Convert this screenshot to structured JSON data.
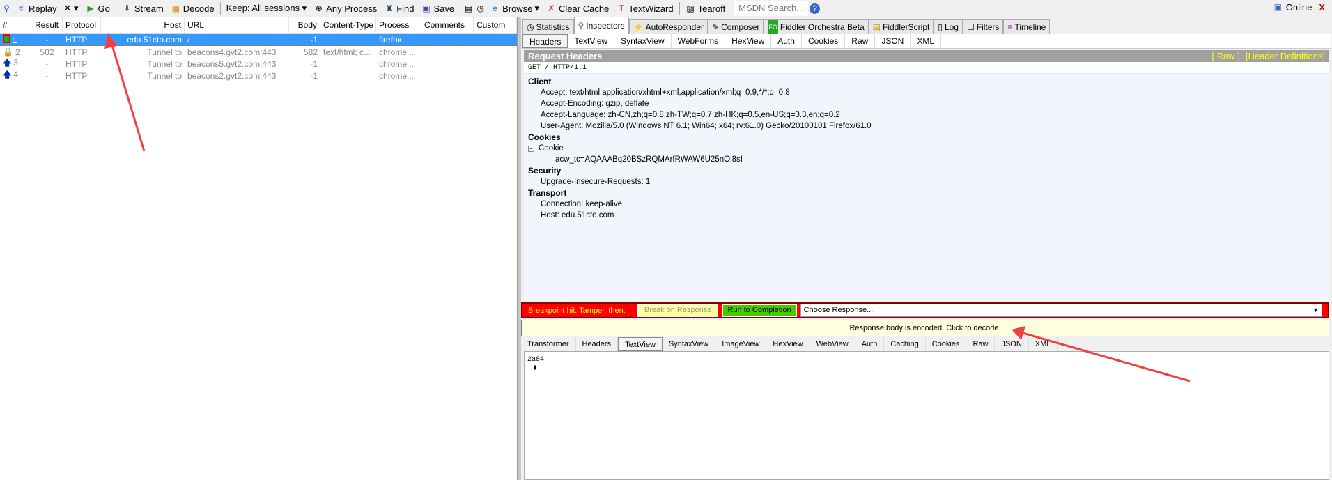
{
  "toolbar": {
    "replay": "Replay",
    "remove": "✕ ▾",
    "go": "Go",
    "stream": "Stream",
    "decode": "Decode",
    "keep": "Keep: All sessions ▾",
    "process": "Any Process",
    "find": "Find",
    "save": "Save",
    "browse": "Browse",
    "clear_cache": "Clear Cache",
    "textwizard": "TextWizard",
    "tearoff": "Tearoff",
    "msdn_placeholder": "MSDN Search...",
    "online": "Online"
  },
  "sessions": {
    "columns": [
      "#",
      "Result",
      "Protocol",
      "Host",
      "URL",
      "Body",
      "Content-Type",
      "Process",
      "Comments",
      "Custom"
    ],
    "rows": [
      {
        "id": "1",
        "result": "-",
        "protocol": "HTTP",
        "host": "edu.51cto.com",
        "url": "/",
        "body": "-1",
        "content_type": "",
        "process": "firefox:...",
        "selected": true
      },
      {
        "id": "2",
        "result": "502",
        "protocol": "HTTP",
        "host": "Tunnel to",
        "url": "beacons4.gvt2.com:443",
        "body": "582",
        "content_type": "text/html; c...",
        "process": "chrome..."
      },
      {
        "id": "3",
        "result": "-",
        "protocol": "HTTP",
        "host": "Tunnel to",
        "url": "beacons5.gvt2.com:443",
        "body": "-1",
        "content_type": "",
        "process": "chrome..."
      },
      {
        "id": "4",
        "result": "-",
        "protocol": "HTTP",
        "host": "Tunnel to",
        "url": "beacons2.gvt2.com:443",
        "body": "-1",
        "content_type": "",
        "process": "chrome..."
      }
    ]
  },
  "tabs": [
    "Statistics",
    "Inspectors",
    "AutoResponder",
    "Composer",
    "Fiddler Orchestra Beta",
    "FiddlerScript",
    "Log",
    "Filters",
    "Timeline"
  ],
  "request_tabs": [
    "Headers",
    "TextView",
    "SyntaxView",
    "WebForms",
    "HexView",
    "Auth",
    "Cookies",
    "Raw",
    "JSON",
    "XML"
  ],
  "request": {
    "title": "Request Headers",
    "raw_link": "[ Raw ]",
    "defs_link": "[Header Definitions]",
    "request_line": "GET / HTTP/1.1",
    "client": "Client",
    "accept": "Accept: text/html,application/xhtml+xml,application/xml;q=0.9,*/*;q=0.8",
    "accept_encoding": "Accept-Encoding: gzip, deflate",
    "accept_language": "Accept-Language: zh-CN,zh;q=0.8,zh-TW;q=0.7,zh-HK;q=0.5,en-US;q=0.3,en;q=0.2",
    "user_agent": "User-Agent: Mozilla/5.0 (Windows NT 6.1; Win64; x64; rv:61.0) Gecko/20100101 Firefox/61.0",
    "cookies": "Cookies",
    "cookie": "Cookie",
    "cookie_value": "acw_tc=AQAAABq20BSzRQMArfRWAW6U25nOl8sI",
    "security": "Security",
    "upgrade": "Upgrade-Insecure-Requests: 1",
    "transport": "Transport",
    "connection": "Connection: keep-alive",
    "host": "Host: edu.51cto.com"
  },
  "breakpoint": {
    "label": "Breakpoint hit. Tamper, then:",
    "break_on_response": "Break on Response",
    "run_to_completion": "Run to Completion",
    "choose_response": "Choose Response..."
  },
  "encoded_notice": "Response body is encoded. Click to decode.",
  "response_tabs": [
    "Transformer",
    "Headers",
    "TextView",
    "SyntaxView",
    "ImageView",
    "HexView",
    "WebView",
    "Auth",
    "Caching",
    "Cookies",
    "Raw",
    "JSON",
    "XML"
  ],
  "response_body": {
    "line1": "2a84",
    "line2": "▮"
  },
  "colors": {
    "selection": "#3399ff",
    "breakpoint_bar": "#ff0000",
    "run_button": "#44cc00",
    "break_button": "#ffff99",
    "annotation_arrow": "#f04040"
  }
}
